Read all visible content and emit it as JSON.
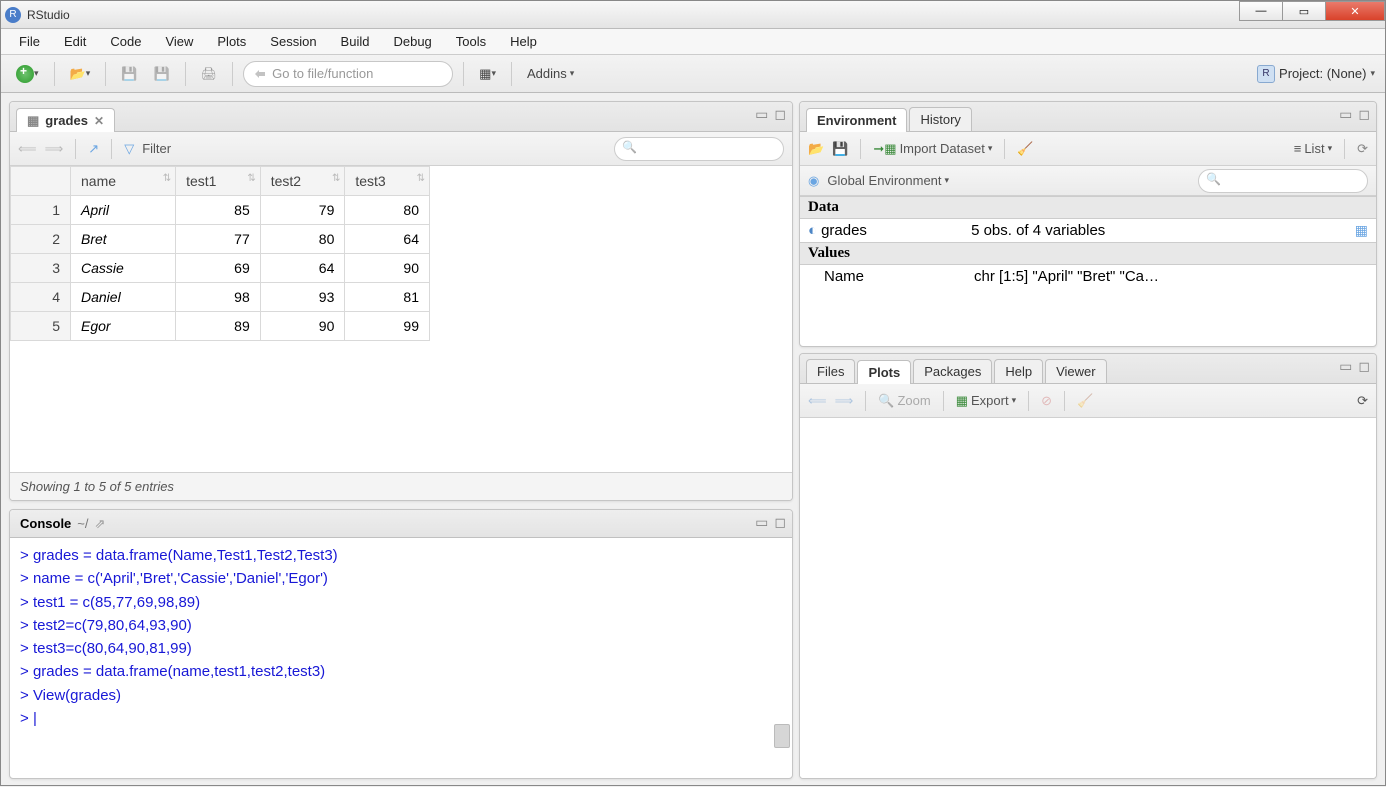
{
  "window": {
    "title": "RStudio"
  },
  "menu": [
    "File",
    "Edit",
    "Code",
    "View",
    "Plots",
    "Session",
    "Build",
    "Debug",
    "Tools",
    "Help"
  ],
  "toolbar": {
    "gotofile_placeholder": "Go to file/function",
    "addins": "Addins",
    "project_label": "Project: (None)"
  },
  "source": {
    "tab_title": "grades",
    "filter_label": "Filter",
    "columns": [
      "name",
      "test1",
      "test2",
      "test3"
    ],
    "rows": [
      {
        "idx": 1,
        "name": "April",
        "test1": 85,
        "test2": 79,
        "test3": 80
      },
      {
        "idx": 2,
        "name": "Bret",
        "test1": 77,
        "test2": 80,
        "test3": 64
      },
      {
        "idx": 3,
        "name": "Cassie",
        "test1": 69,
        "test2": 64,
        "test3": 90
      },
      {
        "idx": 4,
        "name": "Daniel",
        "test1": 98,
        "test2": 93,
        "test3": 81
      },
      {
        "idx": 5,
        "name": "Egor",
        "test1": 89,
        "test2": 90,
        "test3": 99
      }
    ],
    "status": "Showing 1 to 5 of 5 entries"
  },
  "console": {
    "title": "Console",
    "path": "~/",
    "lines": [
      "grades = data.frame(Name,Test1,Test2,Test3)",
      "name = c('April','Bret','Cassie','Daniel','Egor')",
      "test1 = c(85,77,69,98,89)",
      "test2=c(79,80,64,93,90)",
      "test3=c(80,64,90,81,99)",
      "grades = data.frame(name,test1,test2,test3)",
      "View(grades)"
    ]
  },
  "env": {
    "tab_env": "Environment",
    "tab_history": "History",
    "import_label": "Import Dataset",
    "list_label": "List",
    "scope": "Global Environment",
    "data_header": "Data",
    "values_header": "Values",
    "grades_name": "grades",
    "grades_desc": "5 obs. of 4 variables",
    "name_name": "Name",
    "name_desc": "chr [1:5] \"April\" \"Bret\" \"Ca…"
  },
  "plots": {
    "tabs": [
      "Files",
      "Plots",
      "Packages",
      "Help",
      "Viewer"
    ],
    "active_tab": 1,
    "zoom": "Zoom",
    "export": "Export"
  }
}
